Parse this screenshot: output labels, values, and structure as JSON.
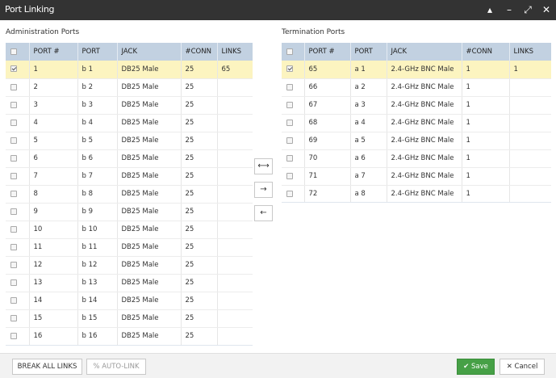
{
  "window": {
    "title": "Port Linking",
    "controls": [
      "▴",
      "–",
      "⤢",
      "✕"
    ]
  },
  "admin": {
    "label": "Administration Ports",
    "columns": [
      "",
      "PORT #",
      "PORT",
      "JACK",
      "#CONN",
      "LINKS"
    ],
    "rows": [
      {
        "checked": true,
        "num": "1",
        "port": "b 1",
        "jack": "DB25 Male",
        "conn": "25",
        "links": "65"
      },
      {
        "checked": false,
        "num": "2",
        "port": "b 2",
        "jack": "DB25 Male",
        "conn": "25",
        "links": ""
      },
      {
        "checked": false,
        "num": "3",
        "port": "b 3",
        "jack": "DB25 Male",
        "conn": "25",
        "links": ""
      },
      {
        "checked": false,
        "num": "4",
        "port": "b 4",
        "jack": "DB25 Male",
        "conn": "25",
        "links": ""
      },
      {
        "checked": false,
        "num": "5",
        "port": "b 5",
        "jack": "DB25 Male",
        "conn": "25",
        "links": ""
      },
      {
        "checked": false,
        "num": "6",
        "port": "b 6",
        "jack": "DB25 Male",
        "conn": "25",
        "links": ""
      },
      {
        "checked": false,
        "num": "7",
        "port": "b 7",
        "jack": "DB25 Male",
        "conn": "25",
        "links": ""
      },
      {
        "checked": false,
        "num": "8",
        "port": "b 8",
        "jack": "DB25 Male",
        "conn": "25",
        "links": ""
      },
      {
        "checked": false,
        "num": "9",
        "port": "b 9",
        "jack": "DB25 Male",
        "conn": "25",
        "links": ""
      },
      {
        "checked": false,
        "num": "10",
        "port": "b 10",
        "jack": "DB25 Male",
        "conn": "25",
        "links": ""
      },
      {
        "checked": false,
        "num": "11",
        "port": "b 11",
        "jack": "DB25 Male",
        "conn": "25",
        "links": ""
      },
      {
        "checked": false,
        "num": "12",
        "port": "b 12",
        "jack": "DB25 Male",
        "conn": "25",
        "links": ""
      },
      {
        "checked": false,
        "num": "13",
        "port": "b 13",
        "jack": "DB25 Male",
        "conn": "25",
        "links": ""
      },
      {
        "checked": false,
        "num": "14",
        "port": "b 14",
        "jack": "DB25 Male",
        "conn": "25",
        "links": ""
      },
      {
        "checked": false,
        "num": "15",
        "port": "b 15",
        "jack": "DB25 Male",
        "conn": "25",
        "links": ""
      },
      {
        "checked": false,
        "num": "16",
        "port": "b 16",
        "jack": "DB25 Male",
        "conn": "25",
        "links": ""
      }
    ]
  },
  "termination": {
    "label": "Termination Ports",
    "columns": [
      "",
      "PORT #",
      "PORT",
      "JACK",
      "#CONN",
      "LINKS"
    ],
    "rows": [
      {
        "checked": true,
        "num": "65",
        "port": "a 1",
        "jack": "2.4-GHz BNC Male",
        "conn": "1",
        "links": "1"
      },
      {
        "checked": false,
        "num": "66",
        "port": "a 2",
        "jack": "2.4-GHz BNC Male",
        "conn": "1",
        "links": ""
      },
      {
        "checked": false,
        "num": "67",
        "port": "a 3",
        "jack": "2.4-GHz BNC Male",
        "conn": "1",
        "links": ""
      },
      {
        "checked": false,
        "num": "68",
        "port": "a 4",
        "jack": "2.4-GHz BNC Male",
        "conn": "1",
        "links": ""
      },
      {
        "checked": false,
        "num": "69",
        "port": "a 5",
        "jack": "2.4-GHz BNC Male",
        "conn": "1",
        "links": ""
      },
      {
        "checked": false,
        "num": "70",
        "port": "a 6",
        "jack": "2.4-GHz BNC Male",
        "conn": "1",
        "links": ""
      },
      {
        "checked": false,
        "num": "71",
        "port": "a 7",
        "jack": "2.4-GHz BNC Male",
        "conn": "1",
        "links": ""
      },
      {
        "checked": false,
        "num": "72",
        "port": "a 8",
        "jack": "2.4-GHz BNC Male",
        "conn": "1",
        "links": ""
      }
    ]
  },
  "middle_buttons": [
    {
      "name": "link-both-button",
      "icon": "⟷"
    },
    {
      "name": "link-right-button",
      "icon": "→"
    },
    {
      "name": "link-left-button",
      "icon": "←"
    }
  ],
  "footer": {
    "break_all": "BREAK ALL LINKS",
    "auto_link": "AUTO-LINK",
    "auto_link_icon": "%",
    "save": "Save",
    "save_icon": "✔",
    "cancel": "Cancel",
    "cancel_icon": "✕"
  },
  "colors": {
    "titlebar": "#333333",
    "header": "#c2d1e1",
    "selected_row": "#fcf4c0",
    "save": "#46a046"
  }
}
